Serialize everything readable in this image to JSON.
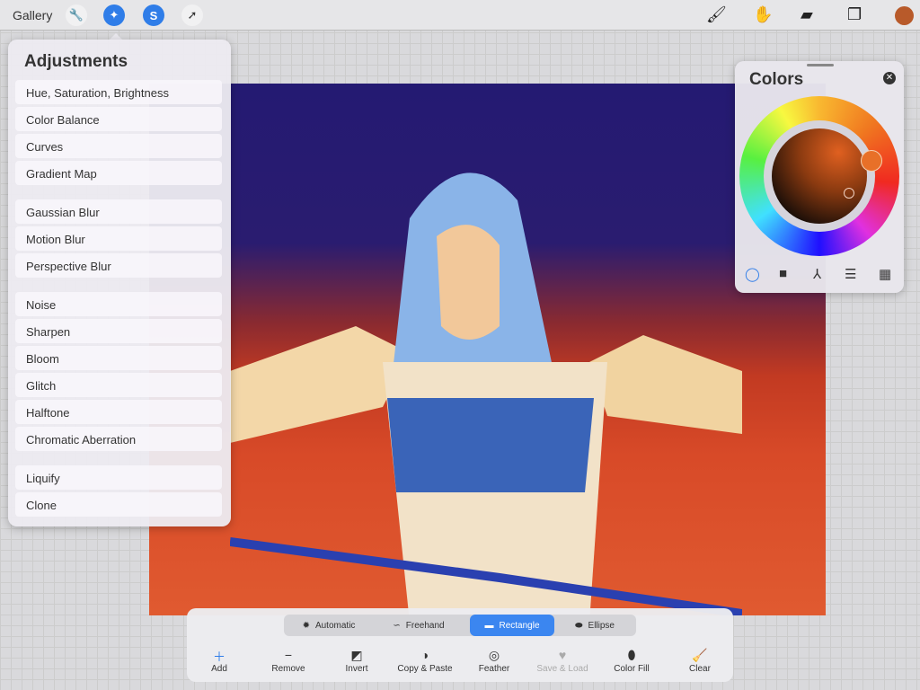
{
  "topbar": {
    "gallery": "Gallery",
    "icons": [
      "wrench-icon",
      "magic-wand-icon",
      "selection-icon",
      "transform-arrow-icon"
    ],
    "right_icons": [
      "brush-icon",
      "smudge-icon",
      "eraser-icon",
      "layers-icon"
    ],
    "current_color": "#b85a2a"
  },
  "adjustments": {
    "title": "Adjustments",
    "groups": [
      [
        "Hue, Saturation, Brightness",
        "Color Balance",
        "Curves",
        "Gradient Map"
      ],
      [
        "Gaussian Blur",
        "Motion Blur",
        "Perspective Blur"
      ],
      [
        "Noise",
        "Sharpen",
        "Bloom",
        "Glitch",
        "Halftone",
        "Chromatic Aberration"
      ],
      [
        "Liquify",
        "Clone"
      ]
    ]
  },
  "colors": {
    "title": "Colors",
    "selected_color": "#e87028",
    "tabs": [
      "disc",
      "classic",
      "harmony",
      "value",
      "palettes"
    ],
    "active_tab": "disc"
  },
  "selection": {
    "modes": [
      "Automatic",
      "Freehand",
      "Rectangle",
      "Ellipse"
    ],
    "active_mode": "Rectangle",
    "actions": [
      {
        "label": "Add",
        "enabled": true
      },
      {
        "label": "Remove",
        "enabled": true
      },
      {
        "label": "Invert",
        "enabled": true
      },
      {
        "label": "Copy & Paste",
        "enabled": true
      },
      {
        "label": "Feather",
        "enabled": true
      },
      {
        "label": "Save & Load",
        "enabled": false
      },
      {
        "label": "Color Fill",
        "enabled": true
      },
      {
        "label": "Clear",
        "enabled": true
      }
    ]
  },
  "accent": "#2f7de8"
}
